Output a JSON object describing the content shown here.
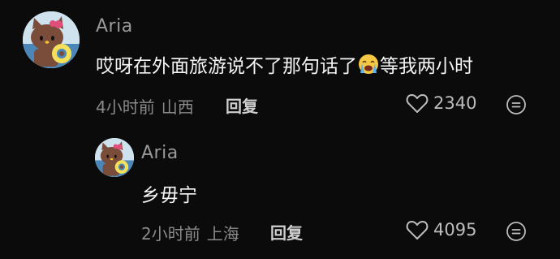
{
  "comments": [
    {
      "username": "Aria",
      "text_before": "哎呀在外面旅游说不了那句话了",
      "emoji": "crying-face-emoji",
      "text_after": "等我两小时",
      "time": "4小时前",
      "location": "山西",
      "reply_label": "回复",
      "likes": "2340"
    },
    {
      "username": "Aria",
      "text": "乡毋宁",
      "time": "2小时前",
      "location": "上海",
      "reply_label": "回复",
      "likes": "4095"
    }
  ],
  "colors": {
    "background": "#0b0b0b",
    "username": "#9a9a9a",
    "text": "#f4f4f4",
    "meta": "#8a8a8a"
  }
}
